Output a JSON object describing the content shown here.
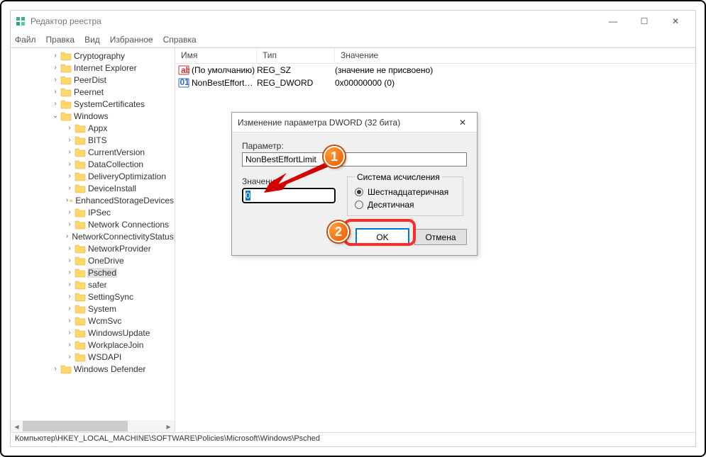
{
  "window": {
    "title": "Редактор реестра"
  },
  "winbtns": {
    "min": "—",
    "max": "☐",
    "close": "✕"
  },
  "menu": [
    "Файл",
    "Правка",
    "Вид",
    "Избранное",
    "Справка"
  ],
  "tree": [
    {
      "l": 58,
      "e": "",
      "n": "Cryptography"
    },
    {
      "l": 58,
      "e": "",
      "n": "Internet Explorer"
    },
    {
      "l": 58,
      "e": "",
      "n": "PeerDist"
    },
    {
      "l": 58,
      "e": "",
      "n": "Peernet"
    },
    {
      "l": 58,
      "e": "",
      "n": "SystemCertificates"
    },
    {
      "l": 58,
      "e": "v",
      "n": "Windows"
    },
    {
      "l": 78,
      "e": "",
      "n": "Appx"
    },
    {
      "l": 78,
      "e": "",
      "n": "BITS"
    },
    {
      "l": 78,
      "e": "",
      "n": "CurrentVersion"
    },
    {
      "l": 78,
      "e": "",
      "n": "DataCollection"
    },
    {
      "l": 78,
      "e": "",
      "n": "DeliveryOptimization"
    },
    {
      "l": 78,
      "e": "",
      "n": "DeviceInstall"
    },
    {
      "l": 78,
      "e": "",
      "n": "EnhancedStorageDevices"
    },
    {
      "l": 78,
      "e": "",
      "n": "IPSec"
    },
    {
      "l": 78,
      "e": "",
      "n": "Network Connections"
    },
    {
      "l": 78,
      "e": "",
      "n": "NetworkConnectivityStatusIndicator"
    },
    {
      "l": 78,
      "e": "",
      "n": "NetworkProvider"
    },
    {
      "l": 78,
      "e": "",
      "n": "OneDrive"
    },
    {
      "l": 78,
      "e": "",
      "n": "Psched",
      "sel": true
    },
    {
      "l": 78,
      "e": "",
      "n": "safer"
    },
    {
      "l": 78,
      "e": "",
      "n": "SettingSync"
    },
    {
      "l": 78,
      "e": "",
      "n": "System"
    },
    {
      "l": 78,
      "e": "",
      "n": "WcmSvc"
    },
    {
      "l": 78,
      "e": "",
      "n": "WindowsUpdate"
    },
    {
      "l": 78,
      "e": "",
      "n": "WorkplaceJoin"
    },
    {
      "l": 78,
      "e": "",
      "n": "WSDAPI"
    },
    {
      "l": 58,
      "e": "",
      "n": "Windows Defender"
    }
  ],
  "cols": {
    "name": "Имя",
    "type": "Тип",
    "value": "Значение"
  },
  "rows": [
    {
      "icon": "str",
      "name": "(По умолчанию)",
      "type": "REG_SZ",
      "value": "(значение не присвоено)"
    },
    {
      "icon": "bin",
      "name": "NonBestEffortLi...",
      "type": "REG_DWORD",
      "value": "0x00000000 (0)"
    }
  ],
  "dialog": {
    "title": "Изменение параметра DWORD (32 бита)",
    "param_label": "Параметр:",
    "param_value": "NonBestEffortLimit",
    "value_label": "Значение:",
    "value_input": "0",
    "base_legend": "Система исчисления",
    "radio_hex": "Шестнадцатеричная",
    "radio_dec": "Десятичная",
    "ok": "OK",
    "cancel": "Отмена"
  },
  "callouts": {
    "one": "1",
    "two": "2"
  },
  "status": "Компьютер\\HKEY_LOCAL_MACHINE\\SOFTWARE\\Policies\\Microsoft\\Windows\\Psched"
}
